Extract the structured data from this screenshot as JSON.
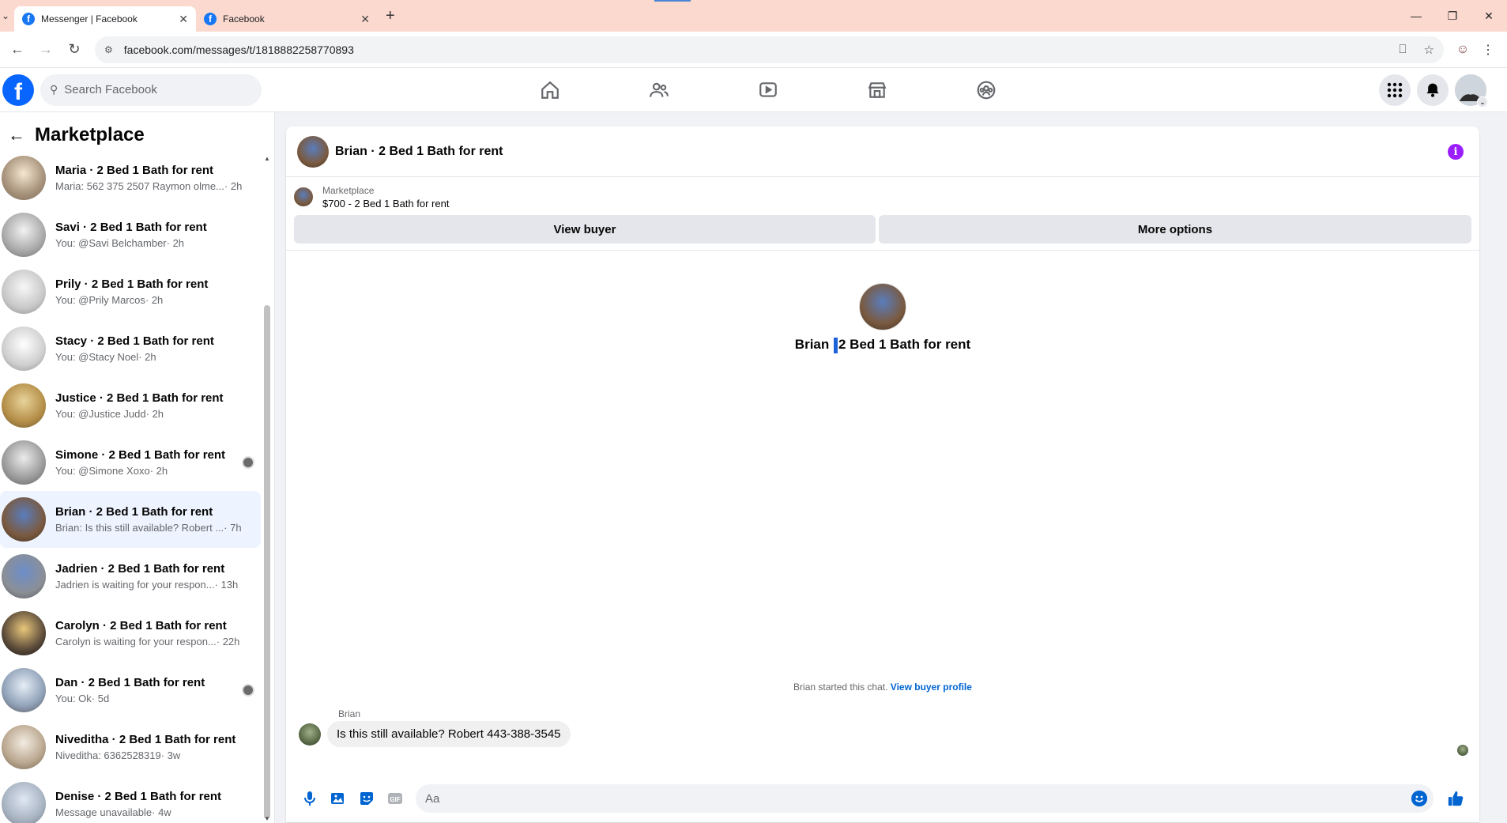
{
  "browser": {
    "tabs": [
      {
        "title": "Messenger | Facebook",
        "active": true
      },
      {
        "title": "Facebook",
        "active": false
      }
    ],
    "url": "facebook.com/messages/t/1818882258770893"
  },
  "fbnav": {
    "search_placeholder": "Search Facebook"
  },
  "sidebar": {
    "title": "Marketplace",
    "conversations": [
      {
        "title": "Maria · 2 Bed 1 Bath for rent",
        "subtitle": "Maria: 562 375 2507 Raymon olme...",
        "time": "· 2h",
        "seen": false,
        "active": false
      },
      {
        "title": "Savi · 2 Bed 1 Bath for rent",
        "subtitle": "You: @Savi Belchamber",
        "time": "· 2h",
        "seen": false,
        "active": false
      },
      {
        "title": "Prily · 2 Bed 1 Bath for rent",
        "subtitle": "You: @Prily Marcos",
        "time": "· 2h",
        "seen": false,
        "active": false
      },
      {
        "title": "Stacy · 2 Bed 1 Bath for rent",
        "subtitle": "You: @Stacy Noel",
        "time": "· 2h",
        "seen": false,
        "active": false
      },
      {
        "title": "Justice · 2 Bed 1 Bath for rent",
        "subtitle": "You: @Justice Judd",
        "time": "· 2h",
        "seen": false,
        "active": false
      },
      {
        "title": "Simone · 2 Bed 1 Bath for rent",
        "subtitle": "You: @Simone Xoxo",
        "time": "· 2h",
        "seen": true,
        "active": false
      },
      {
        "title": "Brian · 2 Bed 1 Bath for rent",
        "subtitle": "Brian: Is this still available? Robert ...",
        "time": "· 7h",
        "seen": false,
        "active": true
      },
      {
        "title": "Jadrien · 2 Bed 1 Bath for rent",
        "subtitle": "Jadrien is waiting for your respon...",
        "time": "· 13h",
        "seen": false,
        "active": false
      },
      {
        "title": "Carolyn · 2 Bed 1 Bath for rent",
        "subtitle": "Carolyn is waiting for your respon...",
        "time": "· 22h",
        "seen": false,
        "active": false
      },
      {
        "title": "Dan · 2 Bed 1 Bath for rent",
        "subtitle": "You: Ok",
        "time": "· 5d",
        "seen": true,
        "active": false
      },
      {
        "title": "Niveditha · 2 Bed 1 Bath for rent",
        "subtitle": "Niveditha: 6362528319",
        "time": "· 3w",
        "seen": false,
        "active": false
      },
      {
        "title": "Denise · 2 Bed 1 Bath for rent",
        "subtitle": "Message unavailable",
        "time": "· 4w",
        "seen": false,
        "active": false
      }
    ]
  },
  "chat": {
    "header_title": "Brian · 2 Bed 1 Bath for rent",
    "listing": {
      "source": "Marketplace",
      "item": "$700 - 2 Bed 1 Bath for rent"
    },
    "buttons": {
      "view_buyer": "View buyer",
      "more_options": "More options"
    },
    "intro": {
      "name_part": "Brian ",
      "rest_part": "2 Bed 1 Bath for rent"
    },
    "started_text": "Brian started this chat. ",
    "started_link": "View buyer profile",
    "sender": "Brian",
    "message": "Is this still available? Robert 443-388-3545",
    "composer_placeholder": "Aa"
  }
}
